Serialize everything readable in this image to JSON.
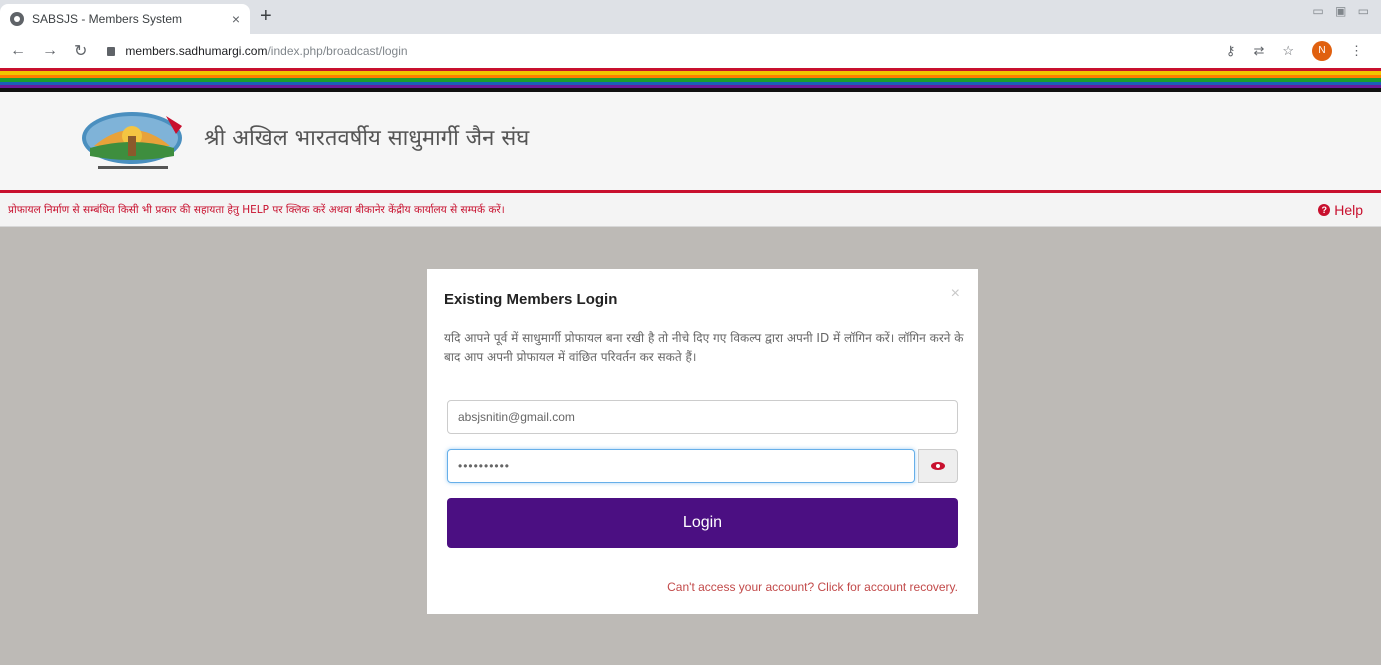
{
  "browser": {
    "tab_title": "SABSJS - Members System",
    "tab_close": "×",
    "new_tab": "+",
    "url_domain": "members.sadhumargi.com",
    "url_path": "/index.php/broadcast/login",
    "profile_initial": "N",
    "icons": [
      "back-icon",
      "forward-icon",
      "reload-icon",
      "lock-icon",
      "key-icon",
      "translate-icon",
      "star-icon",
      "profile-avatar",
      "menu-icon"
    ]
  },
  "header": {
    "site_title": "श्री अखिल भारतवर्षीय साधुमार्गी जैन संघ",
    "notice": "प्रोफायल निर्माण से सम्बंधित किसी भी प्रकार की सहायता हेतु HELP पर क्लिक करें अथवा बीकानेर केंद्रीय कार्यालय से सम्पर्क करें।",
    "help_label": "Help"
  },
  "modal": {
    "title": "Existing Members Login",
    "close": "×",
    "description": "यदि आपने पूर्व में साधुमार्गी प्रोफायल बना रखी है तो नीचे दिए गए विकल्प द्वारा अपनी ID में लॉगिन करें। लॉगिन करने के बाद आप अपनी प्रोफायल में वांछित परिवर्तन कर सकते हैं।",
    "email_value": "absjsnitin@gmail.com",
    "password_value": "••••••••••",
    "login_label": "Login",
    "recovery_text": "Can't access your account? Click for account recovery."
  },
  "colors": {
    "accent": "#c8102e",
    "login_button": "#4b0f82",
    "rainbow": [
      "#c8102e",
      "#f2c500",
      "#ff7f00",
      "#1a9e2f",
      "#1b5fb8",
      "#6a1b9a",
      "#111111"
    ]
  }
}
